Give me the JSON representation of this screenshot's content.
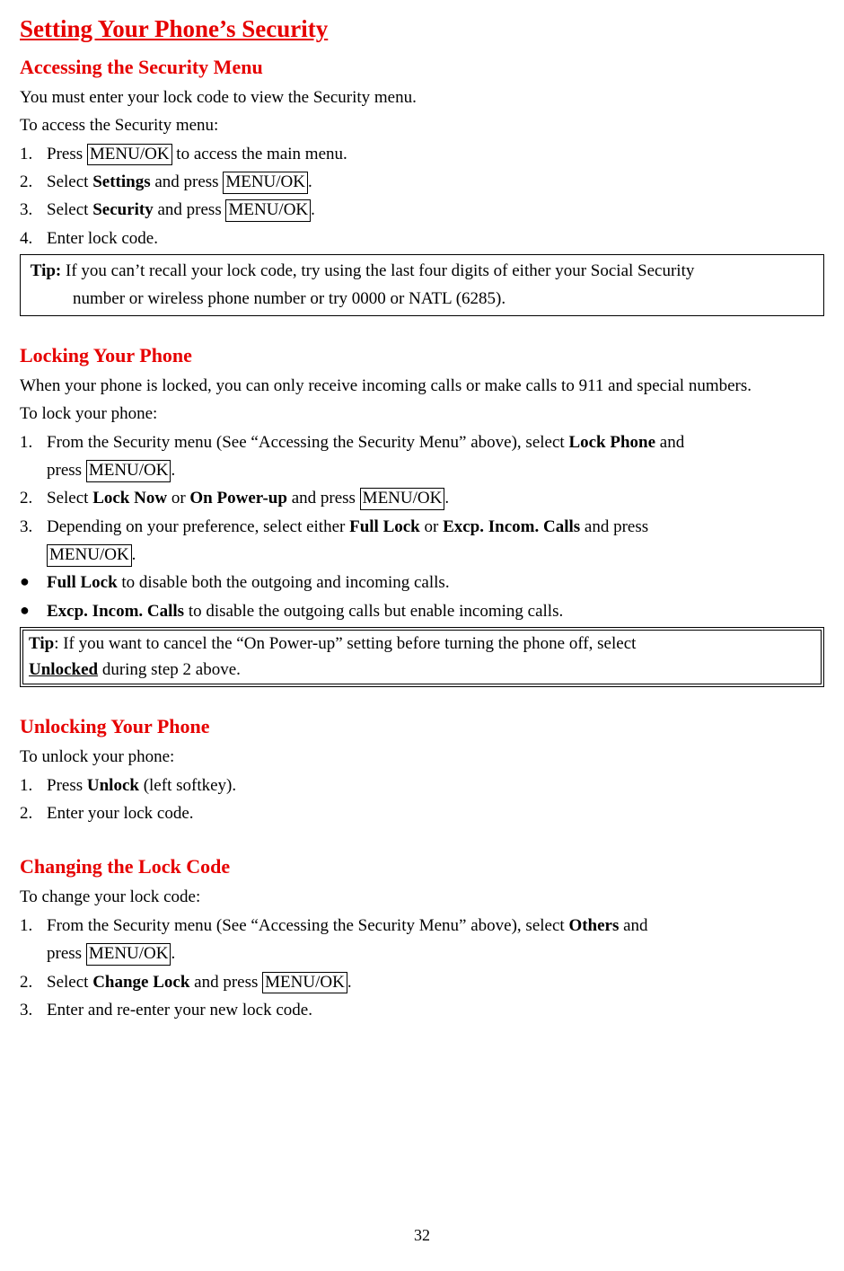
{
  "page_number": "32",
  "key_label": "MENU/OK",
  "title": "Setting Your Phone’s Security",
  "s1": {
    "heading": "Accessing the Security Menu",
    "intro1": "You must enter your lock code to view the Security menu.",
    "intro2": "To access the Security menu:",
    "step1_a": "Press ",
    "step1_b": " to access the main menu.",
    "step2_a": "Select ",
    "step2_bold": "Settings",
    "step2_b": " and press ",
    "step2_c": ".",
    "step3_a": "Select ",
    "step3_bold": "Security",
    "step3_b": " and press ",
    "step3_c": ".",
    "step4": "Enter lock code.",
    "tip_label": "Tip:",
    "tip_a": " If you can’t recall your lock code, try using the last four digits of either your Social Security",
    "tip_b": "number or wireless phone number or try 0000 or NATL (6285)."
  },
  "s2": {
    "heading": "Locking Your Phone",
    "intro1": "When your phone is locked, you can only receive incoming calls or make calls to 911 and special numbers.",
    "intro2": "To lock your phone:",
    "step1_a": "From the Security menu (See “Accessing the Security Menu” above), select ",
    "step1_bold": "Lock Phone",
    "step1_b": " and",
    "step1_c": "press ",
    "step1_d": ".",
    "step2_a": "Select ",
    "step2_bold1": "Lock Now",
    "step2_mid": " or ",
    "step2_bold2": "On Power-up",
    "step2_b": " and press ",
    "step2_c": ".",
    "step3_a": "Depending on your preference, select either ",
    "step3_bold1": "Full Lock",
    "step3_mid": " or ",
    "step3_bold2": "Excp. Incom. Calls",
    "step3_b": " and press",
    "step3_d": ".",
    "bullet1_bold": "Full Lock",
    "bullet1_rest": " to disable both the outgoing and incoming calls.",
    "bullet2_bold": "Excp. Incom. Calls",
    "bullet2_rest": " to disable the outgoing calls but enable incoming calls.",
    "tip_label": "Tip",
    "tip_a": ": If you want to cancel the “On Power-up” setting before turning the phone off, select",
    "tip_bold": "Unlocked",
    "tip_b": " during step 2 above."
  },
  "s3": {
    "heading": "Unlocking Your Phone",
    "intro": "To unlock your phone:",
    "step1_a": "Press ",
    "step1_bold": "Unlock",
    "step1_b": " (left softkey).",
    "step2": "Enter your lock code."
  },
  "s4": {
    "heading": "Changing the Lock Code",
    "intro": "To change your lock code:",
    "step1_a": "From the Security menu (See “Accessing the Security Menu” above), select ",
    "step1_bold": "Others",
    "step1_b": " and",
    "step1_c": "press ",
    "step1_d": ".",
    "step2_a": "Select ",
    "step2_bold": "Change Lock",
    "step2_b": " and press ",
    "step2_c": ".",
    "step3": "Enter and re-enter your new lock code."
  },
  "nums": {
    "n1": "1.",
    "n2": "2.",
    "n3": "3.",
    "n4": "4."
  },
  "bullet": "●"
}
